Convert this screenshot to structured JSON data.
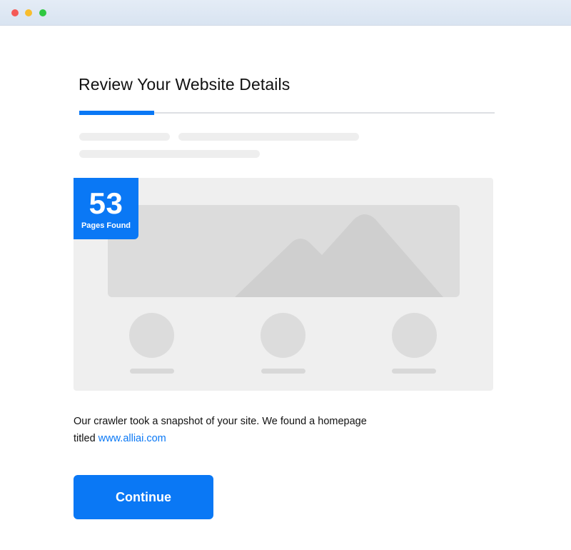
{
  "theme": {
    "accent": "#0a78f5",
    "window_close": "#f45a57",
    "window_minimize": "#f8bd2e",
    "window_maximize": "#2fc841"
  },
  "header": {
    "title": "Review Your Website Details"
  },
  "progress": {
    "step_fraction": 0.18
  },
  "badge": {
    "count": "53",
    "label": "Pages Found"
  },
  "description": {
    "text": "Our crawler took a snapshot of your site. We found a homepage titled",
    "link": "www.alliai.com"
  },
  "actions": {
    "continue_label": "Continue"
  }
}
